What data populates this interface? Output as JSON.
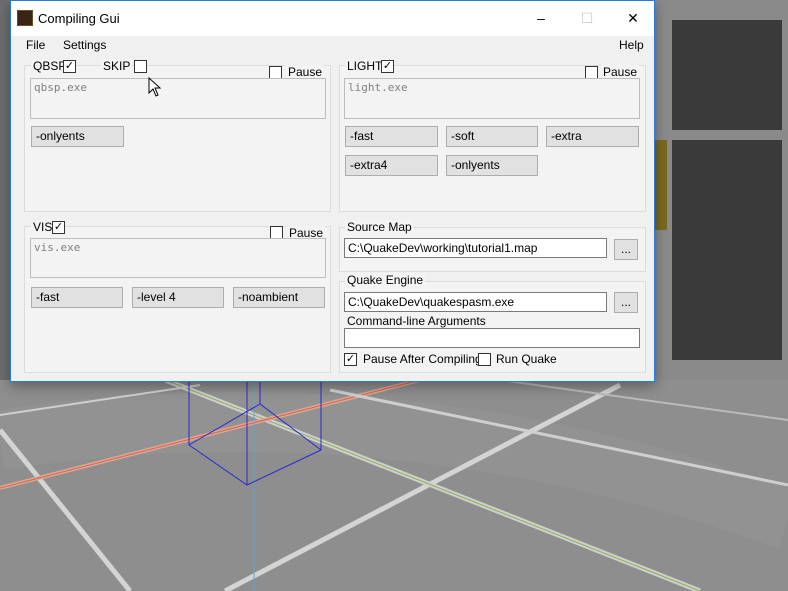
{
  "window": {
    "title": "Compiling Gui",
    "minimize": "–",
    "maximize": "☐",
    "close": "✕",
    "icon": "quake-app-icon"
  },
  "menu": {
    "file": "File",
    "settings": "Settings",
    "help": "Help"
  },
  "qbsp": {
    "label": "QBSP",
    "checked": true,
    "skip_label": "SKIP",
    "skip_checked": false,
    "pause_label": "Pause",
    "pause_checked": false,
    "exe": "qbsp.exe",
    "buttons": [
      "-onlyents"
    ]
  },
  "light": {
    "label": "LIGHT",
    "checked": true,
    "pause_label": "Pause",
    "pause_checked": false,
    "exe": "light.exe",
    "buttons": [
      "-fast",
      "-soft",
      "-extra",
      "-extra4",
      "-onlyents"
    ]
  },
  "vis": {
    "label": "VIS",
    "checked": true,
    "pause_label": "Pause",
    "pause_checked": false,
    "exe": "vis.exe",
    "buttons": [
      "-fast",
      "-level 4",
      "-noambient"
    ]
  },
  "source_map": {
    "label": "Source Map",
    "value": "C:\\QuakeDev\\working\\tutorial1.map",
    "browse": "..."
  },
  "engine": {
    "label": "Quake Engine",
    "value": "C:\\QuakeDev\\quakespasm.exe",
    "browse": "...",
    "args_label": "Command-line Arguments",
    "args_value": "",
    "pause_after_label": "Pause After Compiling",
    "pause_after_checked": true,
    "run_quake_label": "Run Quake",
    "run_quake_checked": false
  }
}
